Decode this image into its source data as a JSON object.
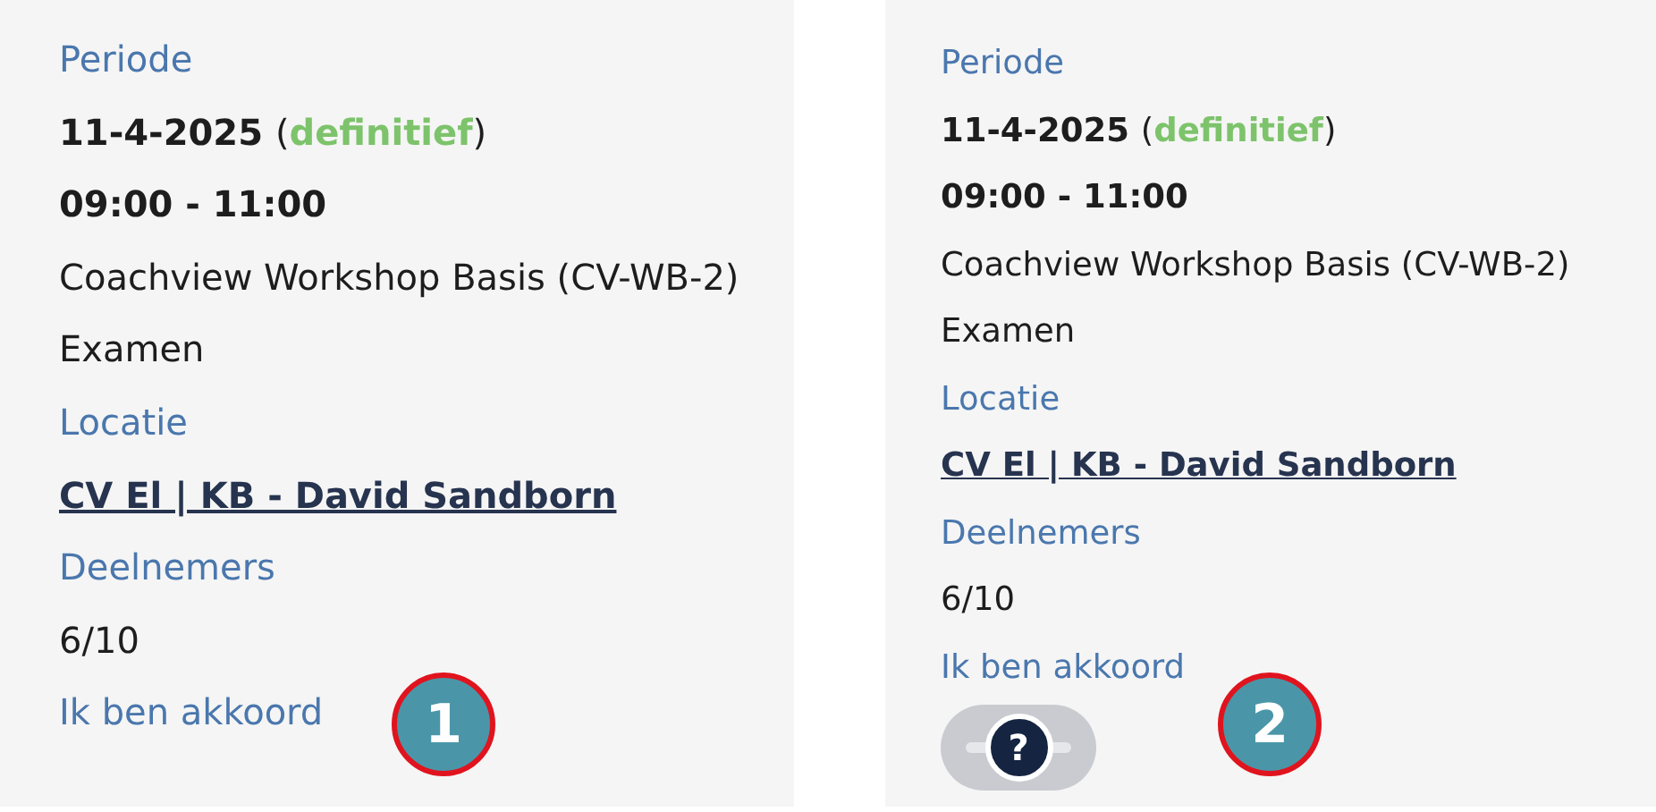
{
  "panels": [
    {
      "callout": "1",
      "fields": [
        {
          "kind": "label",
          "text": "Periode"
        },
        {
          "kind": "date",
          "text": "11-4-2025",
          "open": "(",
          "status": "definitief",
          "close": ")"
        },
        {
          "kind": "strong",
          "text": "09:00 - 11:00"
        },
        {
          "kind": "plain",
          "text": "Coachview Workshop Basis (CV-WB-2)"
        },
        {
          "kind": "plain",
          "text": "Examen"
        },
        {
          "kind": "label",
          "text": "Locatie"
        },
        {
          "kind": "link",
          "text": "CV El | KB - David Sandborn"
        },
        {
          "kind": "label",
          "text": "Deelnemers"
        },
        {
          "kind": "plain",
          "text": "6/10"
        },
        {
          "kind": "label",
          "text": "Ik ben akkoord"
        }
      ]
    },
    {
      "callout": "2",
      "fields": [
        {
          "kind": "label",
          "text": "Periode"
        },
        {
          "kind": "date",
          "text": "11-4-2025",
          "open": "(",
          "status": "definitief",
          "close": ")"
        },
        {
          "kind": "strong",
          "text": "09:00 - 11:00"
        },
        {
          "kind": "plain",
          "text": "Coachview Workshop Basis (CV-WB-2)"
        },
        {
          "kind": "plain",
          "text": "Examen"
        },
        {
          "kind": "label",
          "text": "Locatie"
        },
        {
          "kind": "link",
          "text": "CV El | KB - David Sandborn"
        },
        {
          "kind": "label",
          "text": "Deelnemers"
        },
        {
          "kind": "plain",
          "text": "6/10"
        },
        {
          "kind": "label",
          "text": "Ik ben akkoord"
        }
      ],
      "toggle": {
        "indeterminate": true,
        "symbol": "?"
      }
    }
  ]
}
